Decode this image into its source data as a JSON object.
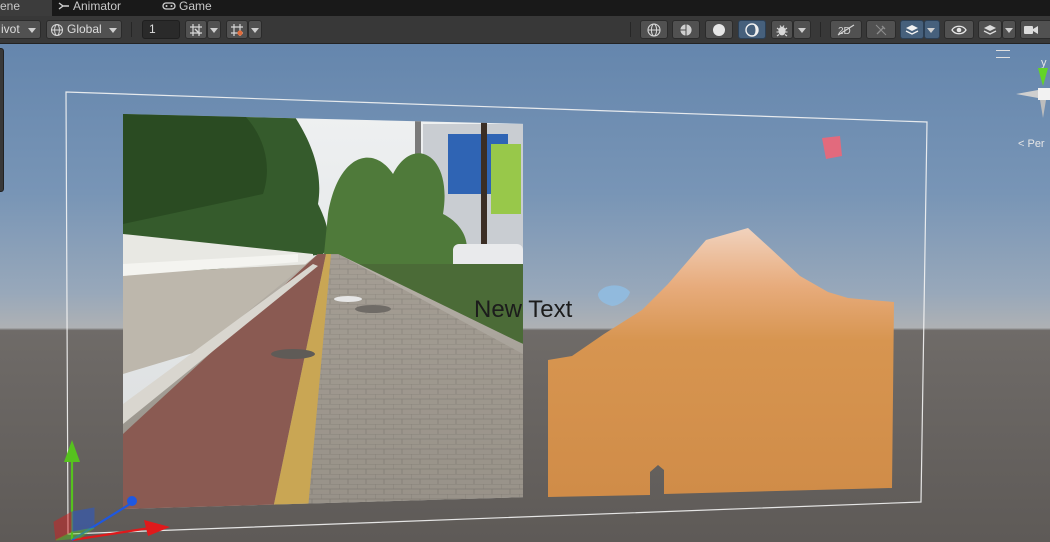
{
  "tabs": [
    {
      "label": "ene",
      "icon": "scene-icon",
      "active": true
    },
    {
      "label": "Animator",
      "icon": "animator-icon",
      "active": false
    },
    {
      "label": "Game",
      "icon": "gamepad-icon",
      "active": false
    }
  ],
  "toolbar": {
    "pivot_label": "ivot",
    "global_label": "Global",
    "snap_value": "1"
  },
  "scene": {
    "text_object": "New Text",
    "view_mode_label": "< Per",
    "gizmo_axis_label": "y"
  },
  "colors": {
    "toolbar_bg": "#383838",
    "tab_bar_bg": "#191919",
    "selected_toggle": "#46607c",
    "sky_top": "#6586ad",
    "ground": "#5e5a57",
    "sprite_orange": "#d38f4c",
    "axis_x": "#e0191b",
    "axis_y": "#56c21e",
    "axis_z": "#1f58e0"
  }
}
